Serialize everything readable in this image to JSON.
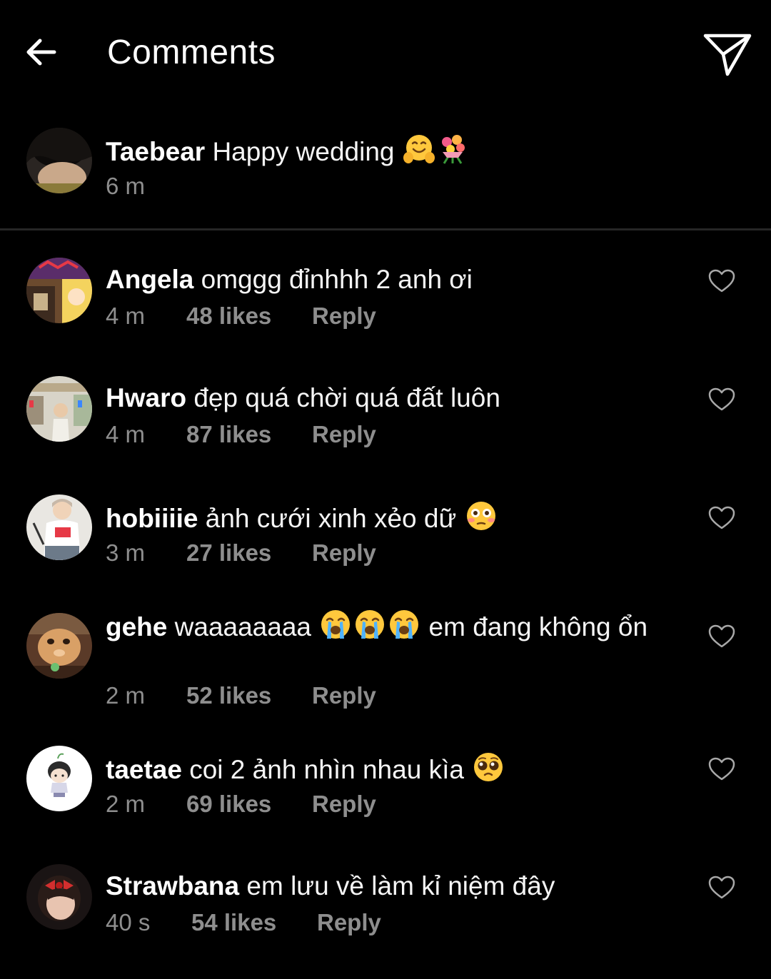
{
  "header": {
    "title": "Comments",
    "back_icon": "arrow-left-icon",
    "share_icon": "paper-plane-icon"
  },
  "caption": {
    "username": "Taebear",
    "text": "Happy wedding",
    "emojis": [
      "hugging-face-emoji",
      "bouquet-emoji"
    ],
    "time": "6 m"
  },
  "comments": [
    {
      "username": "Angela",
      "text": "omggg đỉnhhh 2 anh ơi",
      "time": "4 m",
      "likes": "48 likes",
      "reply": "Reply"
    },
    {
      "username": "Hwaro",
      "text": "đẹp quá chời quá đất luôn",
      "time": "4 m",
      "likes": "87 likes",
      "reply": "Reply"
    },
    {
      "username": "hobiiiie",
      "text": "ảnh cưới xinh xẻo dữ",
      "time": "3 m",
      "likes": "27 likes",
      "reply": "Reply",
      "emojis": [
        "flushed-face-emoji"
      ]
    },
    {
      "username": "gehe",
      "text_before": "waaaaaaaa",
      "text_after": "em đang không ổn",
      "time": "2 m",
      "likes": "52 likes",
      "reply": "Reply",
      "emojis": [
        "loudly-crying-face-emoji",
        "loudly-crying-face-emoji",
        "loudly-crying-face-emoji"
      ]
    },
    {
      "username": "taetae",
      "text": "coi 2 ảnh nhìn nhau kìa",
      "time": "2 m",
      "likes": "69 likes",
      "reply": "Reply",
      "emojis": [
        "pleading-face-emoji"
      ]
    },
    {
      "username": "Strawbana",
      "text": "em lưu về làm kỉ niệm đây",
      "time": "40 s",
      "likes": "54 likes",
      "reply": "Reply"
    }
  ],
  "colors": {
    "background": "#000000",
    "text": "#ffffff",
    "secondary_text": "#8e8e8e",
    "divider": "#262626"
  }
}
